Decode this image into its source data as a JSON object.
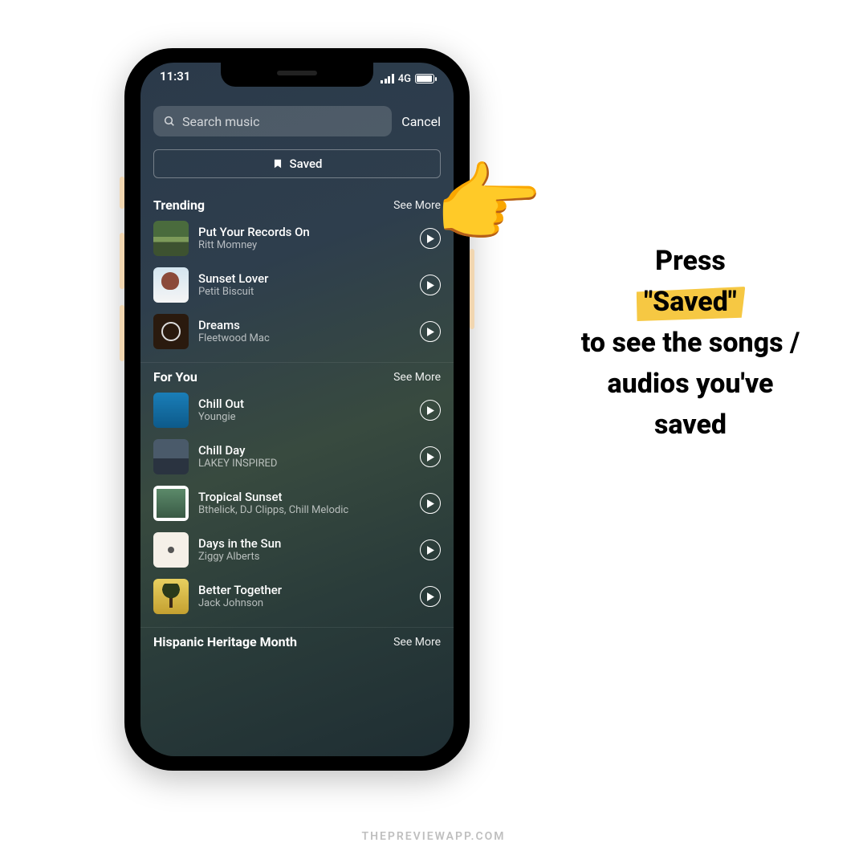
{
  "status": {
    "time": "11:31",
    "network": "4G"
  },
  "search": {
    "placeholder": "Search music",
    "cancel": "Cancel"
  },
  "saved_button": "Saved",
  "sections": [
    {
      "title": "Trending",
      "see_more": "See More",
      "items": [
        {
          "title": "Put Your Records On",
          "artist": "Ritt Momney"
        },
        {
          "title": "Sunset Lover",
          "artist": "Petit Biscuit"
        },
        {
          "title": "Dreams",
          "artist": "Fleetwood Mac"
        }
      ]
    },
    {
      "title": "For You",
      "see_more": "See More",
      "items": [
        {
          "title": "Chill Out",
          "artist": "Youngie"
        },
        {
          "title": "Chill Day",
          "artist": "LAKEY INSPIRED"
        },
        {
          "title": "Tropical Sunset",
          "artist": "Bthelick, DJ Clipps, Chill Melodic"
        },
        {
          "title": "Days in the Sun",
          "artist": "Ziggy Alberts"
        },
        {
          "title": "Better Together",
          "artist": "Jack Johnson"
        }
      ]
    },
    {
      "title": "Hispanic Heritage Month",
      "see_more": "See More",
      "items": []
    }
  ],
  "instruction": {
    "line1": "Press",
    "highlight": "\"Saved\"",
    "line2": "to see the songs / audios you've saved"
  },
  "footer": "THEPREVIEWAPP.COM"
}
